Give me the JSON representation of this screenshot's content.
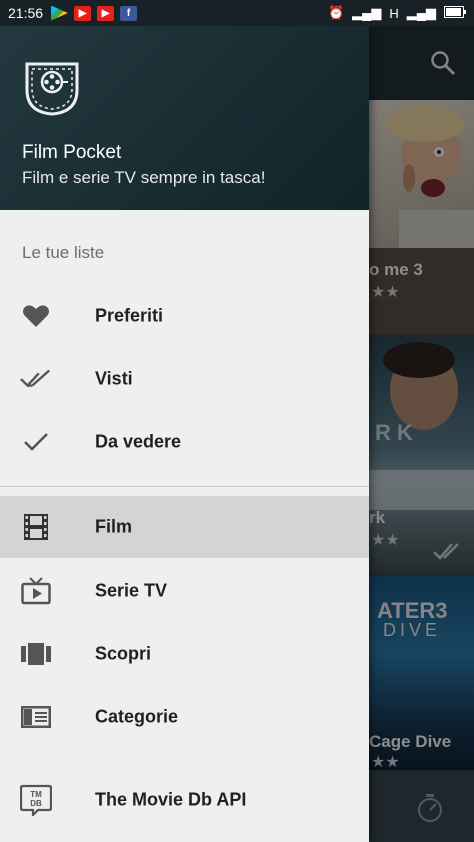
{
  "status_bar": {
    "time": "21:56",
    "network": "H",
    "apps": [
      "play-store-icon",
      "youtube-icon",
      "youtube-icon",
      "facebook-icon"
    ]
  },
  "drawer": {
    "header": {
      "app_name": "Film Pocket",
      "tagline": "Film e serie TV sempre in tasca!"
    },
    "section_title": "Le tue liste",
    "lists": [
      {
        "label": "Preferiti",
        "icon": "heart-icon"
      },
      {
        "label": "Visti",
        "icon": "double-check-icon"
      },
      {
        "label": "Da vedere",
        "icon": "check-icon"
      }
    ],
    "nav": [
      {
        "label": "Film",
        "icon": "film-strip-icon",
        "active": true
      },
      {
        "label": "Serie TV",
        "icon": "tv-icon",
        "active": false
      },
      {
        "label": "Scopri",
        "icon": "carousel-icon",
        "active": false
      },
      {
        "label": "Categorie",
        "icon": "category-list-icon",
        "active": false
      },
      {
        "label": "The Movie Db API",
        "icon": "tmdb-icon",
        "active": false
      }
    ]
  },
  "background": {
    "cards": [
      {
        "title": "o me 3",
        "rating_stars": 2
      },
      {
        "title": "rk",
        "rating_stars": 2
      },
      {
        "title": "Cage Dive",
        "rating_stars": 2
      }
    ],
    "poster_texts": [
      "RK",
      "ATER3",
      "DIVE"
    ]
  },
  "colors": {
    "drawer_header": "#1c3036",
    "active_item_bg": "#d4d4d4",
    "icon_gray": "#555555"
  }
}
